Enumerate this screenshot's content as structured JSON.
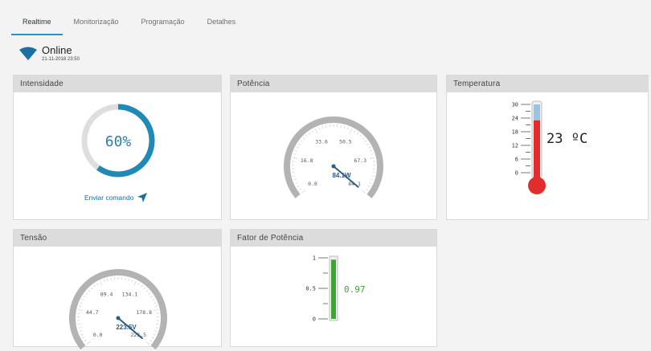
{
  "tabs": [
    {
      "label": "Realtime",
      "active": true
    },
    {
      "label": "Monitorização",
      "active": false
    },
    {
      "label": "Programação",
      "active": false
    },
    {
      "label": "Detalhes",
      "active": false
    }
  ],
  "status": {
    "state": "Online",
    "timestamp": "21-11-2018 23:50",
    "icon": "wifi-icon",
    "color": "#1a6fa3"
  },
  "panels": {
    "intensidade": {
      "title": "Intensidade",
      "value": "60%",
      "fraction": 0.6,
      "send_label": "Enviar comando",
      "accent": "#1f8ab8"
    },
    "potencia": {
      "title": "Potência",
      "ticks": [
        "0.0",
        "16.8",
        "33.6",
        "50.5",
        "67.3",
        "84.1"
      ],
      "value": 84.1,
      "max": 84.1,
      "readout": "84.1W"
    },
    "temperatura": {
      "title": "Temperatura",
      "scale": [
        "30",
        "24",
        "18",
        "12",
        "6",
        "0"
      ],
      "value": 23,
      "max": 30,
      "readout": "23 ºC"
    },
    "tensao": {
      "title": "Tensão",
      "ticks": [
        "0.0",
        "44.7",
        "89.4",
        "134.1",
        "178.8",
        "223.5"
      ],
      "value": 223.5,
      "max": 223.5,
      "readout": "223.5V"
    },
    "fator": {
      "title": "Fator de Potência",
      "scale": [
        "1",
        "0.5",
        "0"
      ],
      "value": 0.97,
      "readout": "0.97"
    }
  }
}
